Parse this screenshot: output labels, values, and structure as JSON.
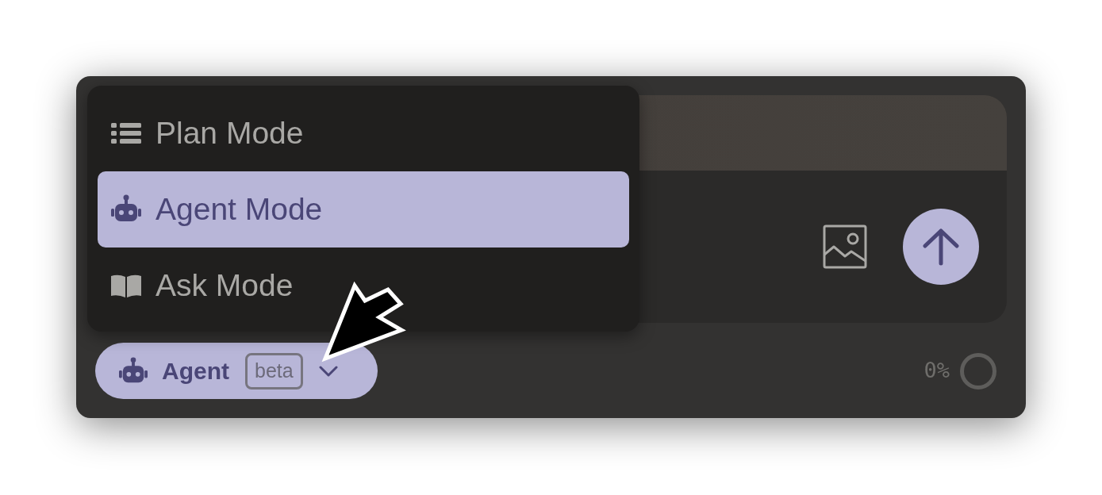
{
  "mode_menu": {
    "items": [
      {
        "label": "Plan Mode",
        "kind": "list",
        "selected": false
      },
      {
        "label": "Agent Mode",
        "kind": "robot",
        "selected": true
      },
      {
        "label": "Ask Mode",
        "kind": "book",
        "selected": false
      }
    ]
  },
  "mode_button": {
    "label": "Agent",
    "badge": "beta"
  },
  "context_usage": {
    "reading": "0%"
  }
}
